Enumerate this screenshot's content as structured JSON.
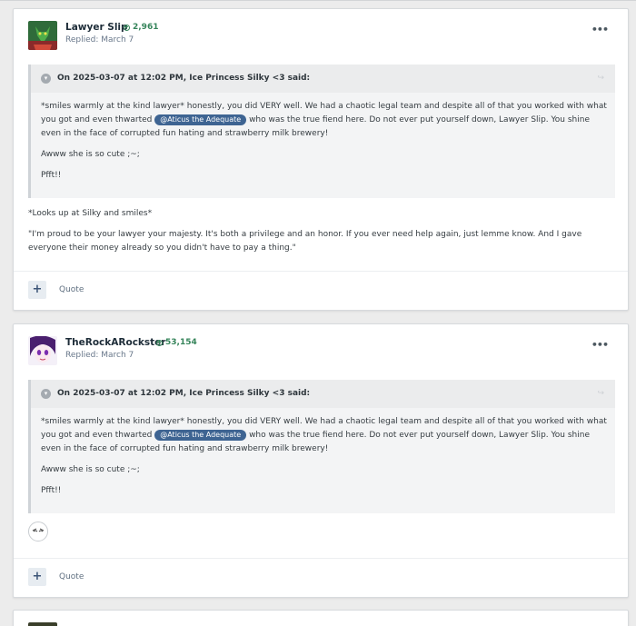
{
  "posts": [
    {
      "author": "Lawyer Slip",
      "reputation": "2,961",
      "replied": "Replied: March 7",
      "quote": {
        "header": "On 2025-03-07 at 12:02 PM, Ice Princess Silky <3 said:",
        "p1_before": "*smiles warmly at the kind lawyer* honestly, you did VERY well. We had a chaotic legal team and despite all of that you worked with what you got and even thwarted ",
        "mention": "@Aticus the Adequate",
        "p1_after": " who was the true fiend here. Do not ever put yourself down, Lawyer Slip. You shine even in the face of corrupted fun hating and strawberry milk brewery!",
        "p2": "Awww she is so cute ;~;",
        "p3": "Pfft!!"
      },
      "content": [
        "*Looks up at Silky and smiles*",
        "\"I'm proud to be your lawyer your majesty. It's both a privilege and an honor. If you ever need help again, just lemme know. And I gave everyone their money already so you didn't have to pay a thing.\""
      ],
      "footer": {
        "plus": "+",
        "quote_label": "Quote"
      }
    },
    {
      "author": "TheRockARockster",
      "reputation": "53,154",
      "replied": "Replied: March 7",
      "quote": {
        "header": "On 2025-03-07 at 12:02 PM, Ice Princess Silky <3 said:",
        "p1_before": "*smiles warmly at the kind lawyer* honestly, you did VERY well. We had a chaotic legal team and despite all of that you worked with what you got and even thwarted ",
        "mention": "@Aticus the Adequate",
        "p1_after": " who was the true fiend here. Do not ever put yourself down, Lawyer Slip. You shine even in the face of corrupted fun hating and strawberry milk brewery!",
        "p2": "Awww she is so cute ;~;",
        "p3": "Pfft!!"
      },
      "footer": {
        "plus": "+",
        "quote_label": "Quote"
      }
    }
  ],
  "menu_glyph": "•••",
  "colors": {
    "reputation": "#35845a",
    "mention_bg": "#3e6492",
    "author": "#1d2c38"
  }
}
